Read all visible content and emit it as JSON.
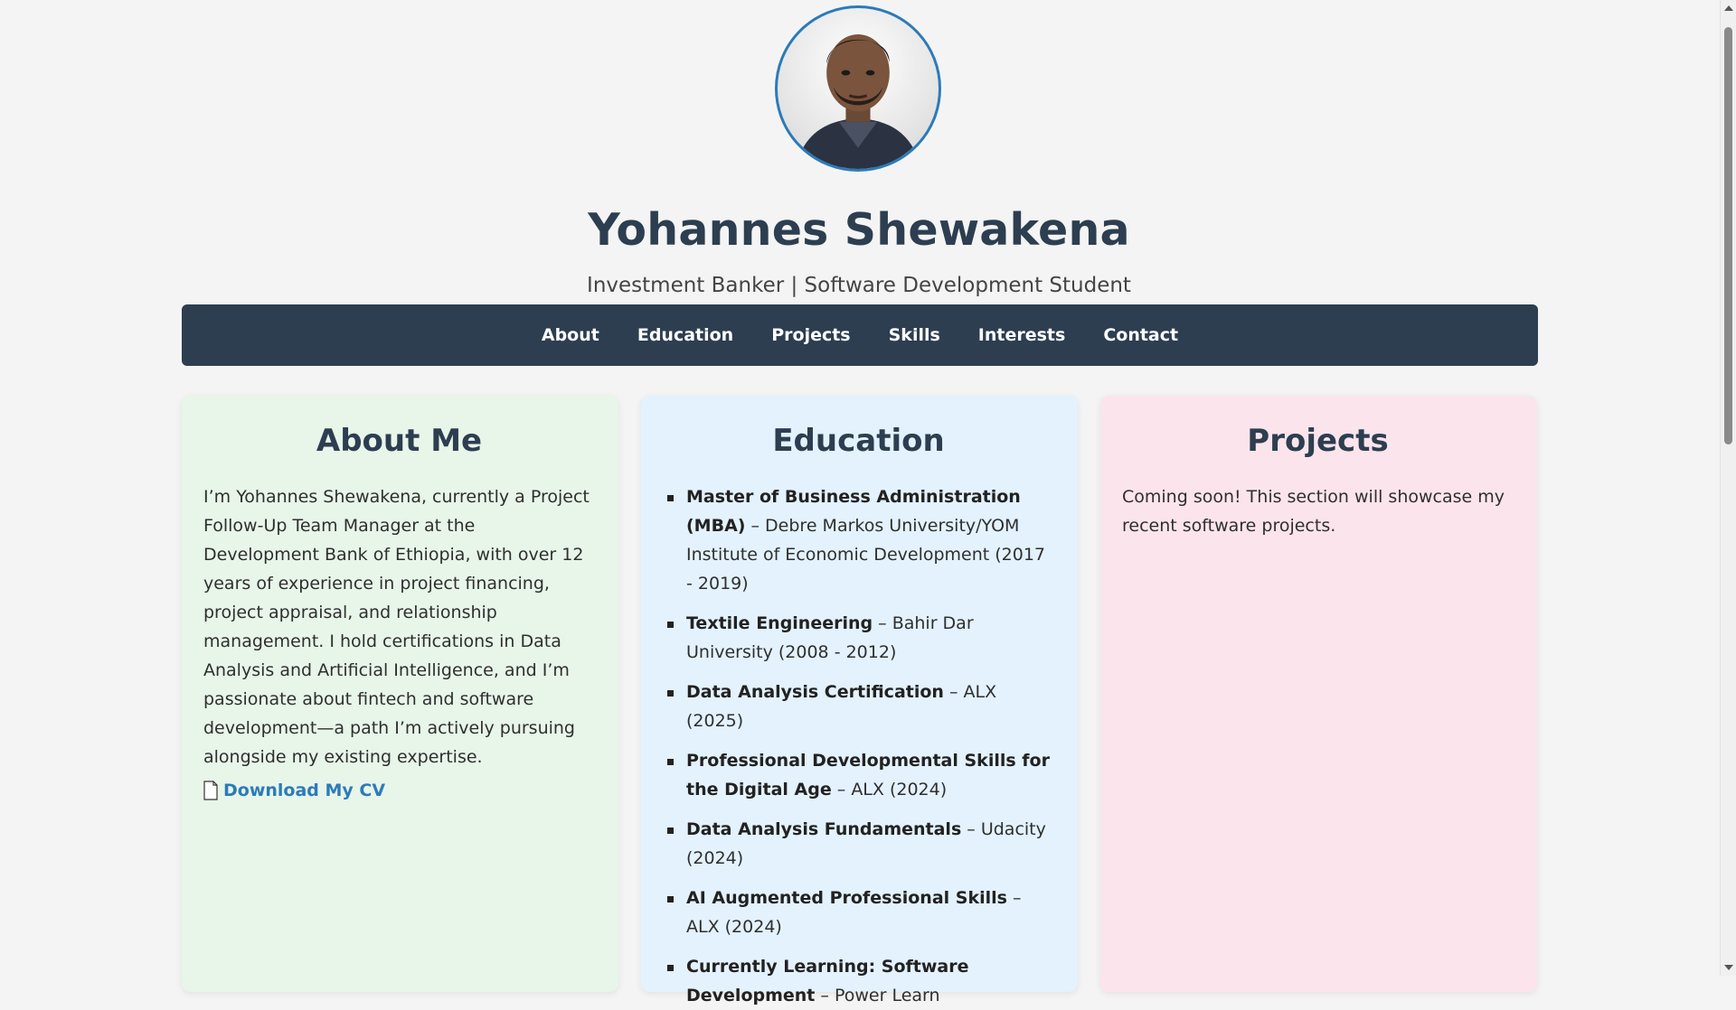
{
  "header": {
    "name": "Yohannes Shewakena",
    "subtitle": "Investment Banker | Software Development Student",
    "avatar_icon": "profile-photo"
  },
  "nav": {
    "items": [
      {
        "label": "About"
      },
      {
        "label": "Education"
      },
      {
        "label": "Projects"
      },
      {
        "label": "Skills"
      },
      {
        "label": "Interests"
      },
      {
        "label": "Contact"
      }
    ]
  },
  "about": {
    "title": "About Me",
    "text": "I’m Yohannes Shewakena, currently a Project Follow-Up Team Manager at the Development Bank of Ethiopia, with over 12 years of experience in project financing, project appraisal, and relationship management. I hold certifications in Data Analysis and Artificial Intelligence, and I’m passionate about fintech and software development—a path I’m actively pursuing alongside my existing expertise.",
    "cv_link": "Download My CV",
    "cv_icon": "document-icon"
  },
  "education": {
    "title": "Education",
    "items": [
      {
        "degree": "Master of Business Administration (MBA)",
        "detail": " – Debre Markos University/YOM Institute of Economic Development (2017 - 2019)"
      },
      {
        "degree": "Textile Engineering",
        "detail": " – Bahir Dar University (2008 - 2012)"
      },
      {
        "degree": "Data Analysis Certification",
        "detail": " – ALX (2025)"
      },
      {
        "degree": "Professional Developmental Skills for the Digital Age",
        "detail": " – ALX (2024)"
      },
      {
        "degree": "Data Analysis Fundamentals",
        "detail": " – Udacity (2024)"
      },
      {
        "degree": "AI Augmented Professional Skills",
        "detail": " – ALX (2024)"
      },
      {
        "degree": "Currently Learning: Software Development",
        "detail": " – Power Learn"
      }
    ]
  },
  "projects": {
    "title": "Projects",
    "text": "Coming soon! This section will showcase my recent software projects."
  },
  "colors": {
    "nav_bg": "#2c3e50",
    "heading": "#2c3e50",
    "link": "#2b7bb9",
    "about_bg": "#e8f5e9",
    "education_bg": "#e3f2fd",
    "projects_bg": "#fce4ec"
  }
}
